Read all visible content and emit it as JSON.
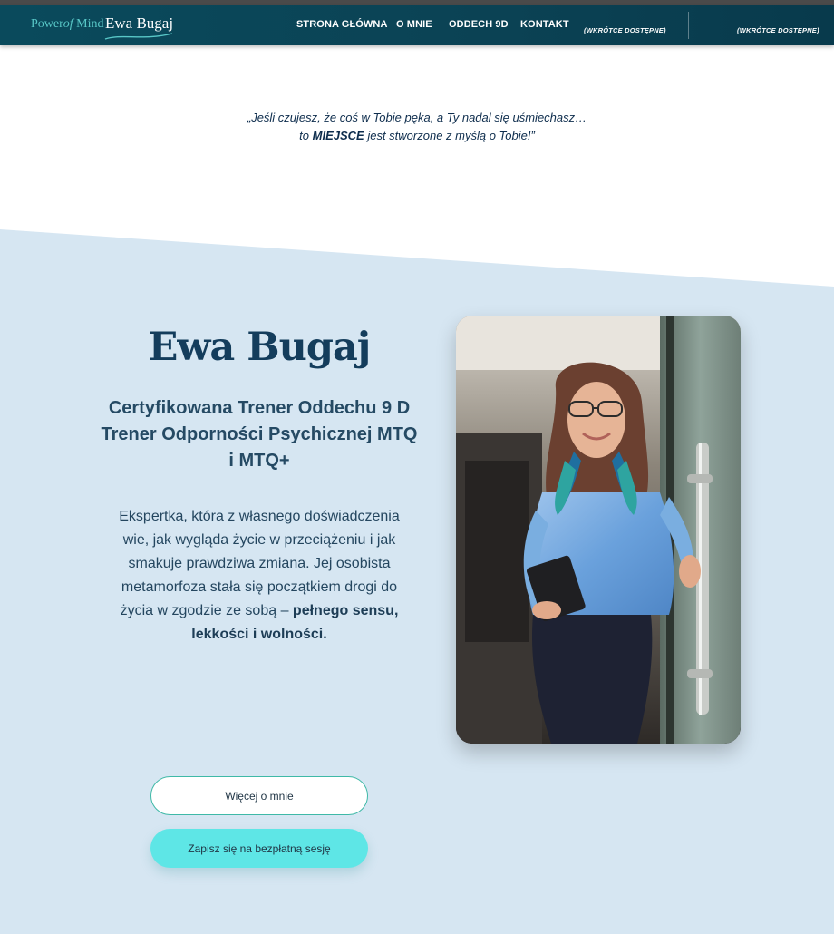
{
  "nav": {
    "logo_power": "Power",
    "logo_of": "of",
    "logo_mind": "Mind",
    "logo_name": "Ewa Bugaj",
    "items": [
      "STRONA GŁÓWNA",
      "O MNIE",
      "ODDECH 9D",
      "KONTAKT"
    ],
    "soon_1": {
      "label": "",
      "soon": "(WKRÓTCE DOSTĘPNE)"
    },
    "soon_2": {
      "label": "",
      "soon": "(WKRÓTCE DOSTĘPNE)"
    }
  },
  "quote": {
    "line1": "„Jeśli czujesz, że coś w Tobie pęka, a Ty nadal się uśmiechasz…",
    "line2_pre": "to ",
    "line2_bold": "MIEJSCE",
    "line2_post": " jest stworzone z myślą o Tobie!”"
  },
  "hero": {
    "name": "Ewa Bugaj",
    "subtitle_1": "Certyfikowana Trener Oddechu 9 D",
    "subtitle_2": "Trener Odporności Psychicznej MTQ",
    "subtitle_3": "i MTQ+",
    "body_text": "Ekspertka, która z własnego doświadczenia wie, jak wygląda życie w przeciążeniu i jak smakuje prawdziwa zmiana. Jej osobista metamorfoza stała się początkiem drogi do życia w zgodzie ze sobą – ",
    "body_bold": "pełnego sensu, lekkości i wolności."
  },
  "buttons": {
    "more": "Więcej o mnie",
    "book": "Zapisz się na bezpłatną sesję"
  },
  "colors": {
    "navbar": "#0a4a5c",
    "accent_teal": "#5ee6e6",
    "hero_bg": "#d6e6f2",
    "heading": "#143d5c"
  }
}
